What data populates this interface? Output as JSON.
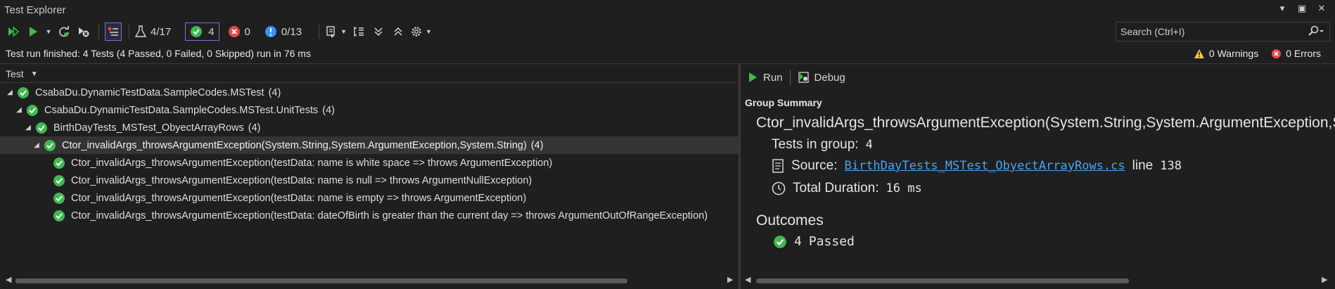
{
  "window": {
    "title": "Test Explorer",
    "controls": [
      "▾",
      "▣",
      "✕"
    ]
  },
  "toolbar": {
    "flask_count": "4/17",
    "passed_count": "4",
    "failed_count": "0",
    "info_count": "0/13"
  },
  "search": {
    "placeholder": "Search (Ctrl+I)"
  },
  "status": {
    "summary": "Test run finished: 4 Tests (4 Passed, 0 Failed, 0 Skipped) run in 76 ms",
    "warnings": "0 Warnings",
    "errors": "0 Errors"
  },
  "tree": {
    "column_header": "Test",
    "rows": [
      {
        "label": "CsabaDu.DynamicTestData.SampleCodes.MSTest",
        "count": "(4)"
      },
      {
        "label": "CsabaDu.DynamicTestData.SampleCodes.MSTest.UnitTests",
        "count": "(4)"
      },
      {
        "label": "BirthDayTests_MSTest_ObyectArrayRows",
        "count": "(4)"
      },
      {
        "label": "Ctor_invalidArgs_throwsArgumentException(System.String,System.ArgumentException,System.String)",
        "count": "(4)"
      },
      {
        "label": "Ctor_invalidArgs_throwsArgumentException(testData: name is white space => throws ArgumentException)",
        "count": ""
      },
      {
        "label": "Ctor_invalidArgs_throwsArgumentException(testData: name is null => throws ArgumentNullException)",
        "count": ""
      },
      {
        "label": "Ctor_invalidArgs_throwsArgumentException(testData: name is empty => throws ArgumentException)",
        "count": ""
      },
      {
        "label": "Ctor_invalidArgs_throwsArgumentException(testData: dateOfBirth is greater than the current day => throws ArgumentOutOfRangeException)",
        "count": ""
      }
    ]
  },
  "detail": {
    "run_label": "Run",
    "debug_label": "Debug",
    "group_summary": "Group Summary",
    "group_name": "Ctor_invalidArgs_throwsArgumentException(System.String,System.ArgumentException,System.String)",
    "tests_in_group_label": "Tests in group:",
    "tests_in_group_value": "4",
    "source_label": "Source:",
    "source_file": "BirthDayTests_MSTest_ObyectArrayRows.cs",
    "source_line_label": "line",
    "source_line": "138",
    "duration_label": "Total Duration:",
    "duration_value": "16 ms",
    "outcomes_label": "Outcomes",
    "passed_count": "4",
    "passed_label": "Passed"
  },
  "colors": {
    "pass": "#3fb950",
    "fail": "#e5484d",
    "info": "#3794ff",
    "warning": "#f2c744",
    "link": "#4ea1f3",
    "selection_border": "#7a73c9"
  }
}
